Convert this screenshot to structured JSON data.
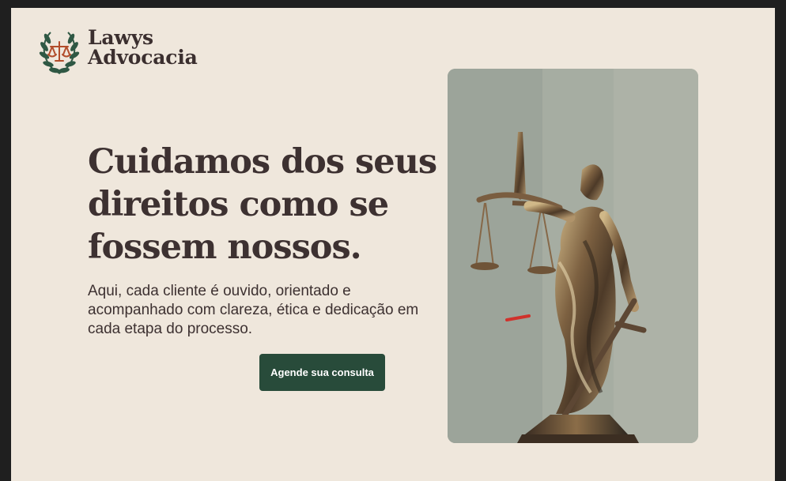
{
  "brand": {
    "name_line1": "Lawys",
    "name_line2": "Advocacia",
    "logo_icon": "scales-laurel-icon"
  },
  "hero": {
    "title_lines": [
      "Cuidamos dos seus",
      "direitos como se",
      "fossem nossos."
    ],
    "subtitle_lines": [
      "Aqui, cada cliente é ouvido, orientado e",
      "acompanhado com clareza, ética e dedicação em",
      "cada etapa do processo."
    ],
    "cta_label": "Agende sua consulta",
    "image_icon": "lady-justice-statue-image"
  },
  "colors": {
    "background": "#efe7dc",
    "text": "#3d3131",
    "accent": "#284b3a",
    "icon_accent": "#b24d2b"
  }
}
